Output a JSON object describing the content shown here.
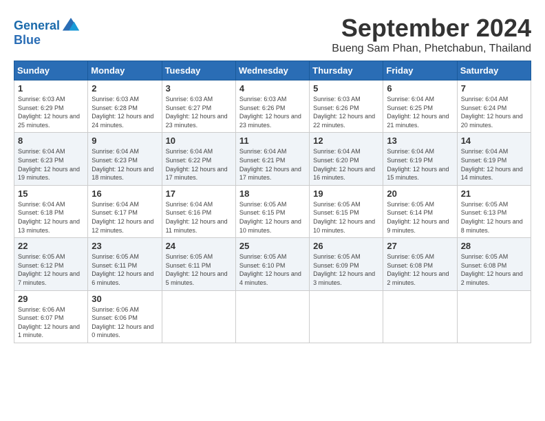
{
  "header": {
    "logo_line1": "General",
    "logo_line2": "Blue",
    "month": "September 2024",
    "location": "Bueng Sam Phan, Phetchabun, Thailand"
  },
  "weekdays": [
    "Sunday",
    "Monday",
    "Tuesday",
    "Wednesday",
    "Thursday",
    "Friday",
    "Saturday"
  ],
  "weeks": [
    [
      {
        "day": "1",
        "sunrise": "6:03 AM",
        "sunset": "6:29 PM",
        "daylight": "12 hours and 25 minutes."
      },
      {
        "day": "2",
        "sunrise": "6:03 AM",
        "sunset": "6:28 PM",
        "daylight": "12 hours and 24 minutes."
      },
      {
        "day": "3",
        "sunrise": "6:03 AM",
        "sunset": "6:27 PM",
        "daylight": "12 hours and 23 minutes."
      },
      {
        "day": "4",
        "sunrise": "6:03 AM",
        "sunset": "6:26 PM",
        "daylight": "12 hours and 23 minutes."
      },
      {
        "day": "5",
        "sunrise": "6:03 AM",
        "sunset": "6:26 PM",
        "daylight": "12 hours and 22 minutes."
      },
      {
        "day": "6",
        "sunrise": "6:04 AM",
        "sunset": "6:25 PM",
        "daylight": "12 hours and 21 minutes."
      },
      {
        "day": "7",
        "sunrise": "6:04 AM",
        "sunset": "6:24 PM",
        "daylight": "12 hours and 20 minutes."
      }
    ],
    [
      {
        "day": "8",
        "sunrise": "6:04 AM",
        "sunset": "6:23 PM",
        "daylight": "12 hours and 19 minutes."
      },
      {
        "day": "9",
        "sunrise": "6:04 AM",
        "sunset": "6:23 PM",
        "daylight": "12 hours and 18 minutes."
      },
      {
        "day": "10",
        "sunrise": "6:04 AM",
        "sunset": "6:22 PM",
        "daylight": "12 hours and 17 minutes."
      },
      {
        "day": "11",
        "sunrise": "6:04 AM",
        "sunset": "6:21 PM",
        "daylight": "12 hours and 17 minutes."
      },
      {
        "day": "12",
        "sunrise": "6:04 AM",
        "sunset": "6:20 PM",
        "daylight": "12 hours and 16 minutes."
      },
      {
        "day": "13",
        "sunrise": "6:04 AM",
        "sunset": "6:19 PM",
        "daylight": "12 hours and 15 minutes."
      },
      {
        "day": "14",
        "sunrise": "6:04 AM",
        "sunset": "6:19 PM",
        "daylight": "12 hours and 14 minutes."
      }
    ],
    [
      {
        "day": "15",
        "sunrise": "6:04 AM",
        "sunset": "6:18 PM",
        "daylight": "12 hours and 13 minutes."
      },
      {
        "day": "16",
        "sunrise": "6:04 AM",
        "sunset": "6:17 PM",
        "daylight": "12 hours and 12 minutes."
      },
      {
        "day": "17",
        "sunrise": "6:04 AM",
        "sunset": "6:16 PM",
        "daylight": "12 hours and 11 minutes."
      },
      {
        "day": "18",
        "sunrise": "6:05 AM",
        "sunset": "6:15 PM",
        "daylight": "12 hours and 10 minutes."
      },
      {
        "day": "19",
        "sunrise": "6:05 AM",
        "sunset": "6:15 PM",
        "daylight": "12 hours and 10 minutes."
      },
      {
        "day": "20",
        "sunrise": "6:05 AM",
        "sunset": "6:14 PM",
        "daylight": "12 hours and 9 minutes."
      },
      {
        "day": "21",
        "sunrise": "6:05 AM",
        "sunset": "6:13 PM",
        "daylight": "12 hours and 8 minutes."
      }
    ],
    [
      {
        "day": "22",
        "sunrise": "6:05 AM",
        "sunset": "6:12 PM",
        "daylight": "12 hours and 7 minutes."
      },
      {
        "day": "23",
        "sunrise": "6:05 AM",
        "sunset": "6:11 PM",
        "daylight": "12 hours and 6 minutes."
      },
      {
        "day": "24",
        "sunrise": "6:05 AM",
        "sunset": "6:11 PM",
        "daylight": "12 hours and 5 minutes."
      },
      {
        "day": "25",
        "sunrise": "6:05 AM",
        "sunset": "6:10 PM",
        "daylight": "12 hours and 4 minutes."
      },
      {
        "day": "26",
        "sunrise": "6:05 AM",
        "sunset": "6:09 PM",
        "daylight": "12 hours and 3 minutes."
      },
      {
        "day": "27",
        "sunrise": "6:05 AM",
        "sunset": "6:08 PM",
        "daylight": "12 hours and 2 minutes."
      },
      {
        "day": "28",
        "sunrise": "6:05 AM",
        "sunset": "6:08 PM",
        "daylight": "12 hours and 2 minutes."
      }
    ],
    [
      {
        "day": "29",
        "sunrise": "6:06 AM",
        "sunset": "6:07 PM",
        "daylight": "12 hours and 1 minute."
      },
      {
        "day": "30",
        "sunrise": "6:06 AM",
        "sunset": "6:06 PM",
        "daylight": "12 hours and 0 minutes."
      },
      null,
      null,
      null,
      null,
      null
    ]
  ]
}
